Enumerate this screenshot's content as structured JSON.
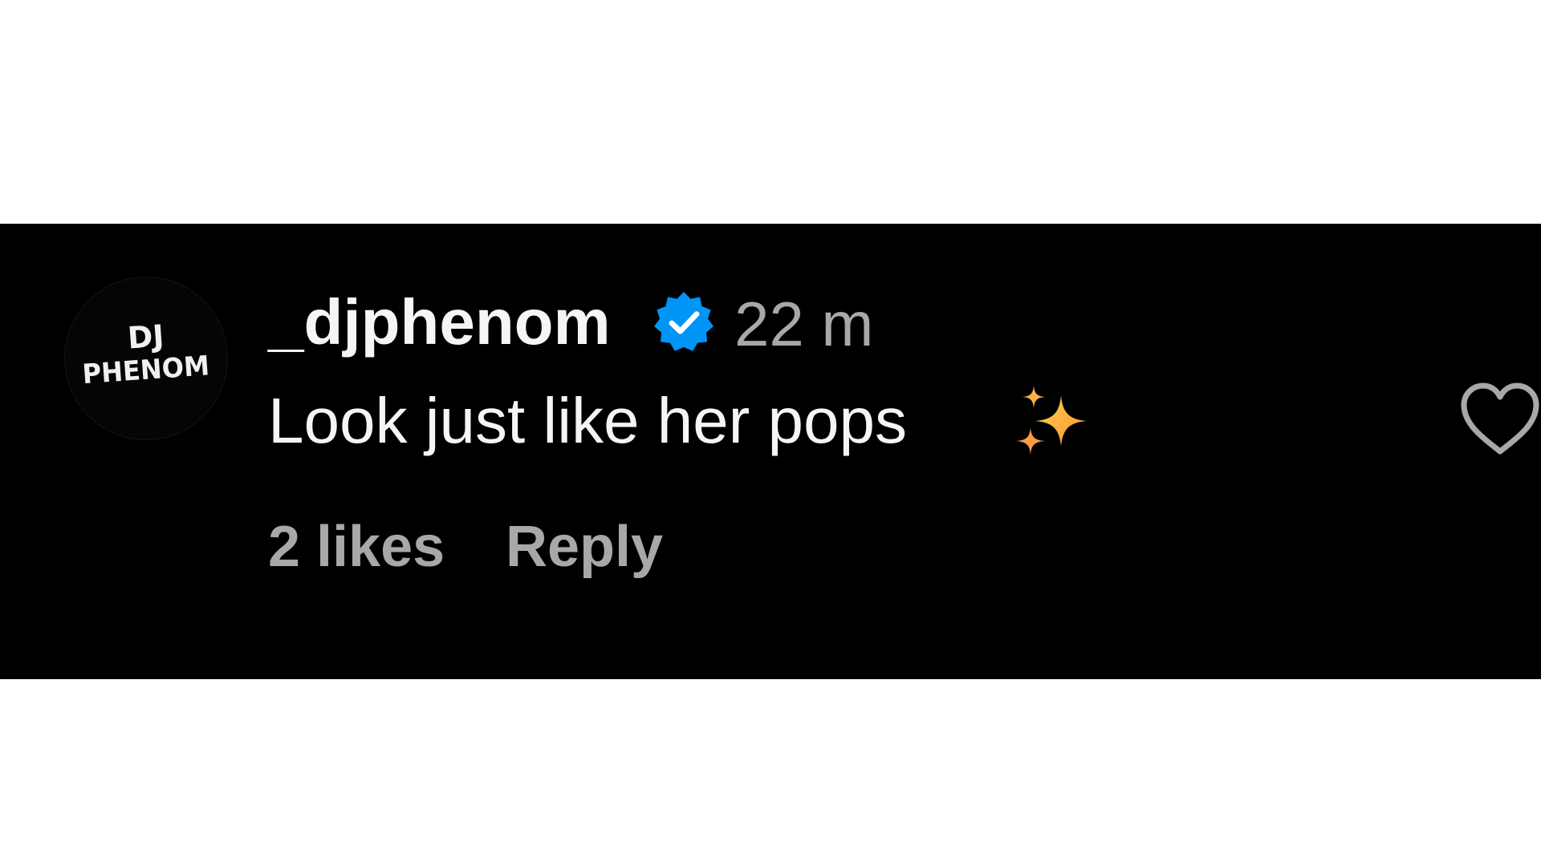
{
  "comment": {
    "username": "_djphenom",
    "verified": true,
    "timestamp": "22 m",
    "text": "Look just like her pops",
    "emoji": "sparkles",
    "likes_label": "2 likes",
    "reply_label": "Reply",
    "avatar_logo": {
      "line1": "DJ",
      "line2": "PHENOM"
    }
  },
  "colors": {
    "background": "#000000",
    "primary_text": "#f5f5f5",
    "secondary_text": "#a8a8a8",
    "verified_badge": "#0095f6"
  },
  "icons": {
    "verified": "verified-badge-icon",
    "emoji": "sparkles-icon",
    "like": "heart-outline-icon"
  }
}
